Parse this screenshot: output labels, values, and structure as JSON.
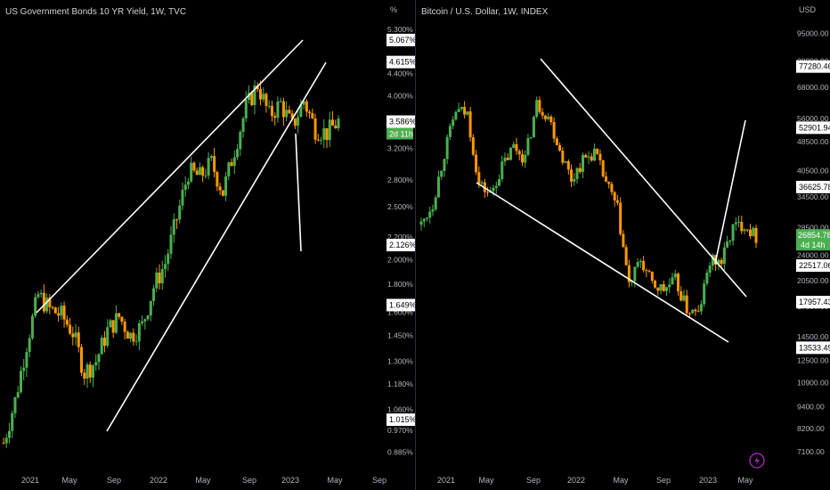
{
  "colors": {
    "up": "#26a69a",
    "down": "#ff9800",
    "up_bright": "#4caf50",
    "line": "#ffffff",
    "bg": "#000000",
    "axis_text": "#b2b5be",
    "badge_bg": "#ffffff",
    "badge_text": "#000000",
    "live_bg": "#4caf50",
    "icon": "#9c27b0"
  },
  "left": {
    "title": "US Government Bonds 10 YR Yield, 1W, TVC",
    "unit": "%",
    "y_ticks": [
      "5.300%",
      "4.400%",
      "4.000%",
      "3.200%",
      "2.800%",
      "2.500%",
      "2.200%",
      "2.000%",
      "1.800%",
      "1.600%",
      "1.450%",
      "1.300%",
      "1.180%",
      "1.060%",
      "0.970%",
      "0.885%"
    ],
    "x_ticks": [
      "2021",
      "May",
      "Sep",
      "2022",
      "May",
      "Sep",
      "2023",
      "May",
      "Sep"
    ],
    "badges": [
      "5.067%",
      "4.615%",
      "3.586%",
      "2.126%",
      "1.649%",
      "1.015%"
    ],
    "live_label": "2d 11h",
    "icon": "none"
  },
  "right": {
    "title": "Bitcoin / U.S. Dollar, 1W, INDEX",
    "unit": "USD",
    "y_ticks": [
      "95000.00",
      "80000.00",
      "68000.00",
      "56000.00",
      "48500.00",
      "40500.00",
      "34500.00",
      "28500.00",
      "24000.00",
      "20500.00",
      "17500.00",
      "14500.00",
      "12500.00",
      "10900.00",
      "9400.00",
      "8200.00",
      "7100.00"
    ],
    "x_ticks": [
      "2021",
      "May",
      "Sep",
      "2022",
      "May",
      "Sep",
      "2023",
      "May"
    ],
    "badges": [
      "77280.46",
      "52901.94",
      "36625.78",
      "22517.06",
      "17957.43",
      "13533.49"
    ],
    "live_price": "26854.78",
    "live_label": "4d 14h",
    "icon": "lightning-icon"
  },
  "chart_data": [
    {
      "type": "candlestick",
      "title": "US Government Bonds 10 YR Yield, 1W, TVC",
      "ylabel": "%",
      "scale": "log",
      "ylim": [
        0.86,
        5.4
      ],
      "x_ticks": [
        "2021",
        "May",
        "Sep",
        "2022",
        "May",
        "Sep",
        "2023",
        "May",
        "Sep"
      ],
      "series": [
        {
          "date": "2020-12",
          "value": 0.92
        },
        {
          "date": "2021-01",
          "value": 1.1
        },
        {
          "date": "2021-02",
          "value": 1.4
        },
        {
          "date": "2021-03",
          "value": 1.72
        },
        {
          "date": "2021-04",
          "value": 1.62
        },
        {
          "date": "2021-05",
          "value": 1.58
        },
        {
          "date": "2021-06",
          "value": 1.47
        },
        {
          "date": "2021-07",
          "value": 1.24
        },
        {
          "date": "2021-08",
          "value": 1.3
        },
        {
          "date": "2021-09",
          "value": 1.48
        },
        {
          "date": "2021-10",
          "value": 1.57
        },
        {
          "date": "2021-11",
          "value": 1.45
        },
        {
          "date": "2021-12",
          "value": 1.51
        },
        {
          "date": "2022-01",
          "value": 1.78
        },
        {
          "date": "2022-02",
          "value": 1.97
        },
        {
          "date": "2022-03",
          "value": 2.38
        },
        {
          "date": "2022-04",
          "value": 2.9
        },
        {
          "date": "2022-05",
          "value": 2.84
        },
        {
          "date": "2022-06",
          "value": 3.01
        },
        {
          "date": "2022-07",
          "value": 2.66
        },
        {
          "date": "2022-08",
          "value": 3.19
        },
        {
          "date": "2022-09",
          "value": 3.8
        },
        {
          "date": "2022-10",
          "value": 4.2
        },
        {
          "date": "2022-11",
          "value": 3.68
        },
        {
          "date": "2022-12",
          "value": 3.87
        },
        {
          "date": "2023-01",
          "value": 3.51
        },
        {
          "date": "2023-02",
          "value": 3.92
        },
        {
          "date": "2023-03",
          "value": 3.48
        },
        {
          "date": "2023-04",
          "value": 3.42
        },
        {
          "date": "2023-05",
          "value": 3.59
        }
      ],
      "current_price": 3.586,
      "annotations": [
        "5.067%",
        "4.615%",
        "3.586%",
        "2.126%",
        "1.649%",
        "1.015%"
      ]
    },
    {
      "type": "candlestick",
      "title": "Bitcoin / U.S. Dollar, 1W, INDEX",
      "ylabel": "USD",
      "scale": "log",
      "ylim": [
        6800,
        100000
      ],
      "x_ticks": [
        "2021",
        "May",
        "Sep",
        "2022",
        "May",
        "Sep",
        "2023",
        "May"
      ],
      "series": [
        {
          "date": "2020-12",
          "value": 29000
        },
        {
          "date": "2021-01",
          "value": 33100
        },
        {
          "date": "2021-02",
          "value": 45200
        },
        {
          "date": "2021-03",
          "value": 58800
        },
        {
          "date": "2021-04",
          "value": 57700
        },
        {
          "date": "2021-05",
          "value": 37300
        },
        {
          "date": "2021-06",
          "value": 35000
        },
        {
          "date": "2021-07",
          "value": 41500
        },
        {
          "date": "2021-08",
          "value": 47100
        },
        {
          "date": "2021-09",
          "value": 43800
        },
        {
          "date": "2021-10",
          "value": 61300
        },
        {
          "date": "2021-11",
          "value": 57000
        },
        {
          "date": "2021-12",
          "value": 46300
        },
        {
          "date": "2022-01",
          "value": 38500
        },
        {
          "date": "2022-02",
          "value": 43200
        },
        {
          "date": "2022-03",
          "value": 45500
        },
        {
          "date": "2022-04",
          "value": 37700
        },
        {
          "date": "2022-05",
          "value": 31800
        },
        {
          "date": "2022-06",
          "value": 19900
        },
        {
          "date": "2022-07",
          "value": 23300
        },
        {
          "date": "2022-08",
          "value": 20000
        },
        {
          "date": "2022-09",
          "value": 19400
        },
        {
          "date": "2022-10",
          "value": 20500
        },
        {
          "date": "2022-11",
          "value": 17200
        },
        {
          "date": "2022-12",
          "value": 16600
        },
        {
          "date": "2023-01",
          "value": 23100
        },
        {
          "date": "2023-02",
          "value": 23100
        },
        {
          "date": "2023-03",
          "value": 28500
        },
        {
          "date": "2023-04",
          "value": 29200
        },
        {
          "date": "2023-05",
          "value": 26850
        }
      ],
      "current_price": 26854.78,
      "annotations": [
        "77280.46",
        "52901.94",
        "36625.78",
        "22517.06",
        "17957.43",
        "13533.49"
      ]
    }
  ]
}
